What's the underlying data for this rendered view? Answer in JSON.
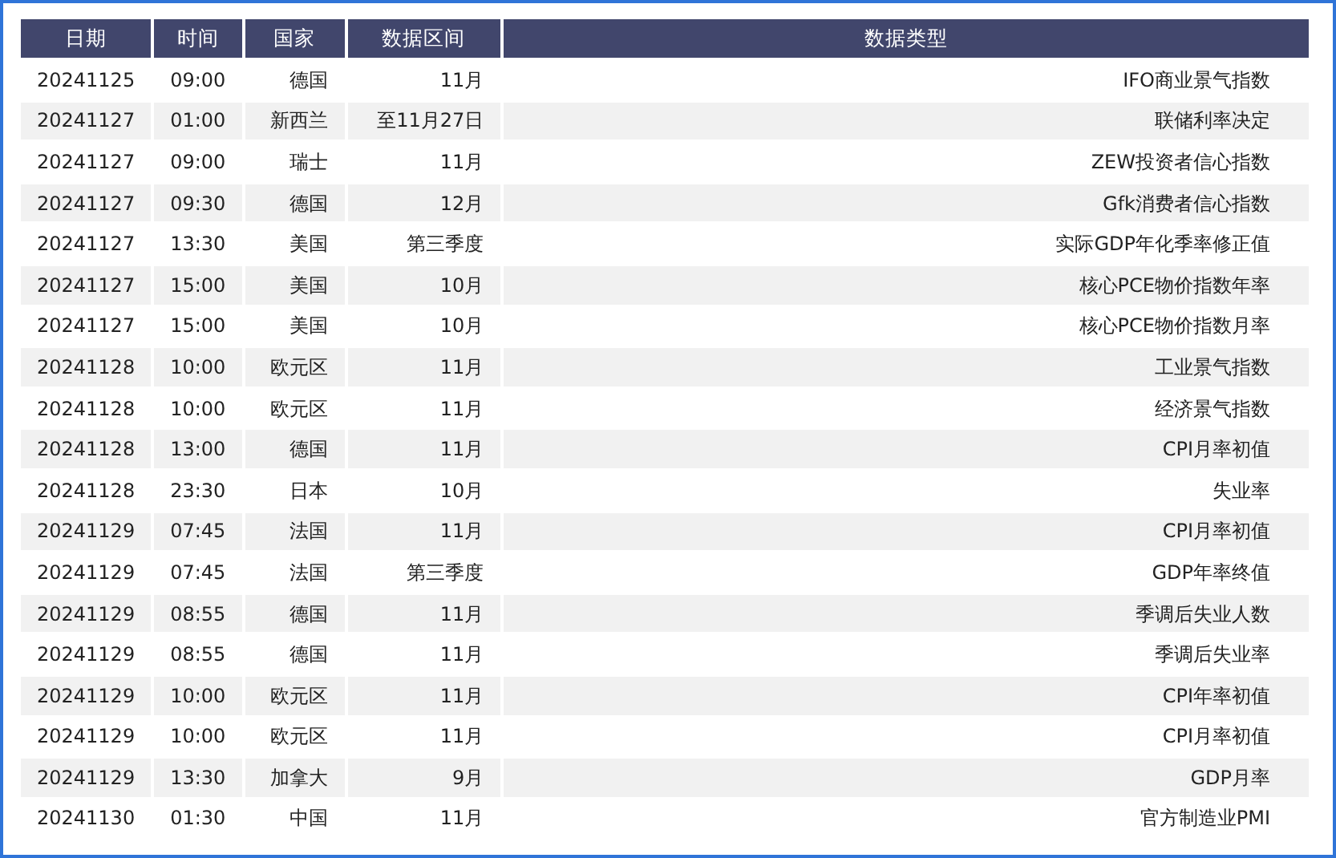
{
  "table": {
    "columns": [
      "日期",
      "时间",
      "国家",
      "数据区间",
      "数据类型"
    ],
    "rows": [
      [
        "20241125",
        "09:00",
        "德国",
        "11月",
        "IFO商业景气指数"
      ],
      [
        "20241127",
        "01:00",
        "新西兰",
        "至11月27日",
        "联储利率决定"
      ],
      [
        "20241127",
        "09:00",
        "瑞士",
        "11月",
        "ZEW投资者信心指数"
      ],
      [
        "20241127",
        "09:30",
        "德国",
        "12月",
        "Gfk消费者信心指数"
      ],
      [
        "20241127",
        "13:30",
        "美国",
        "第三季度",
        "实际GDP年化季率修正值"
      ],
      [
        "20241127",
        "15:00",
        "美国",
        "10月",
        "核心PCE物价指数年率"
      ],
      [
        "20241127",
        "15:00",
        "美国",
        "10月",
        "核心PCE物价指数月率"
      ],
      [
        "20241128",
        "10:00",
        "欧元区",
        "11月",
        "工业景气指数"
      ],
      [
        "20241128",
        "10:00",
        "欧元区",
        "11月",
        "经济景气指数"
      ],
      [
        "20241128",
        "13:00",
        "德国",
        "11月",
        "CPI月率初值"
      ],
      [
        "20241128",
        "23:30",
        "日本",
        "10月",
        "失业率"
      ],
      [
        "20241129",
        "07:45",
        "法国",
        "11月",
        "CPI月率初值"
      ],
      [
        "20241129",
        "07:45",
        "法国",
        "第三季度",
        "GDP年率终值"
      ],
      [
        "20241129",
        "08:55",
        "德国",
        "11月",
        "季调后失业人数"
      ],
      [
        "20241129",
        "08:55",
        "德国",
        "11月",
        "季调后失业率"
      ],
      [
        "20241129",
        "10:00",
        "欧元区",
        "11月",
        "CPI年率初值"
      ],
      [
        "20241129",
        "10:00",
        "欧元区",
        "11月",
        "CPI月率初值"
      ],
      [
        "20241129",
        "13:30",
        "加拿大",
        "9月",
        "GDP月率"
      ],
      [
        "20241130",
        "01:30",
        "中国",
        "11月",
        "官方制造业PMI"
      ]
    ]
  }
}
